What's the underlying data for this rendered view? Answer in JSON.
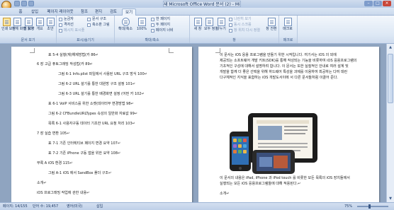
{
  "titlebar": {
    "title": "새 Microsoft Office Word 문서 (2) - Microsoft Word",
    "window_buttons": [
      "minimize-icon",
      "maximize-icon",
      "close-icon"
    ]
  },
  "tabs": [
    {
      "label": "홈"
    },
    {
      "label": "삽입"
    },
    {
      "label": "페이지 레이아웃"
    },
    {
      "label": "참조"
    },
    {
      "label": "편지"
    },
    {
      "label": "검토"
    },
    {
      "label": "보기"
    }
  ],
  "active_tab": "보기",
  "ribbon": {
    "groups": [
      {
        "label": "문서 보기",
        "buttons": [
          "인쇄 모양",
          "전체 화면 읽기",
          "웹 모양",
          "개요",
          "초안"
        ]
      },
      {
        "label": "표시/숨기기",
        "buttons": [
          "눈금자",
          "격자선",
          "메시지 표시줄",
          "문서 구조",
          "축소판 그림"
        ]
      },
      {
        "label": "확대/축소",
        "buttons": [
          "확대/축소",
          "100%",
          "한 페이지",
          "두 페이지",
          "페이지 너비"
        ]
      },
      {
        "label": "창",
        "buttons": [
          "새 창",
          "모두 정렬",
          "나누기",
          "나란히 보기",
          "동시 스크롤",
          "창 위치 다시 정렬",
          "창 전환"
        ]
      },
      {
        "label": "매크로",
        "buttons": [
          "매크로"
        ]
      }
    ]
  },
  "left_page": {
    "lines": [
      "표 5-4 실행(재)해제방법(카 86↵",
      "6 장 고급 퓨토그래밍 작성법(카 89↵",
      "그림 6-1 Info.plist 파일에서 사용된 URL 구조 방식 100↵",
      "그림 6-2 URL 설기를 통한 대원방 구조 설정 101↵",
      "그림 6-3 URL 설기를 통한 배경화면 설정 (어떤 카 102↵",
      "표 6-1 VoIP 서비스를 위한 소켓(데이터부 변경방법 98↵",
      "그림 6-2 CFBundleURLTypes 속성의 일반화 자료값 99↵",
      "목록 6-1 사용자구동 데이터 기초한 URL 요청 처리 103↵",
      "7 장 실습 변환 105↵",
      "표 7-1 기존 인터렉티브 페이지 변경 요약 107↵",
      "표 7-2 기존 iPhone 구동 앱을 위한 요약 108↵",
      "부록 A iOS 환경 115↵",
      "그림 A-1 iOS 에서 SandBox 폴더 구조↵",
      "소개↵",
      "iOS 프로그래밍 작업에 관한 내용↵"
    ]
  },
  "right_page": {
    "top_lines": [
      "이 문서는 iOS 응용 프로그램을 만들기 위한 시작입니다. 여기서는 iOS 의 외에",
      "제공되는 소프트웨어 개발 키트(SDK)를 통해 작성되는 기능을 비롯하여 iOS 응용프로그램의",
      "기초적인 구성에 대해서 설명하려 합니다. 이 문서는 또한 실질적인 안내로 여러 설계 및",
      "개발을 함께 더 좋은 선택을 위해 하드웨어 특성을 과제를 이용하여 최공하는 다여 데런",
      "다구체적인 지식을 표함하는 iOS 개발도서이에 서 다른 문서들처럼 이끌어 준다."
    ],
    "bottom_lines": [
      "이 문서의 내용은 iPad, iPhone 과 iPod touch 를 비롯한 모든 목록의 iOS 장치들에서",
      "실행되는 모든 iOS 응용프로그램들에 대해 적용된다.↵",
      "소개↵"
    ]
  },
  "status": {
    "page": "페이지: 14/155",
    "words": "단어 수: 19,457",
    "language": "영어(미국)",
    "mode": "삽입",
    "zoom": "75%"
  }
}
